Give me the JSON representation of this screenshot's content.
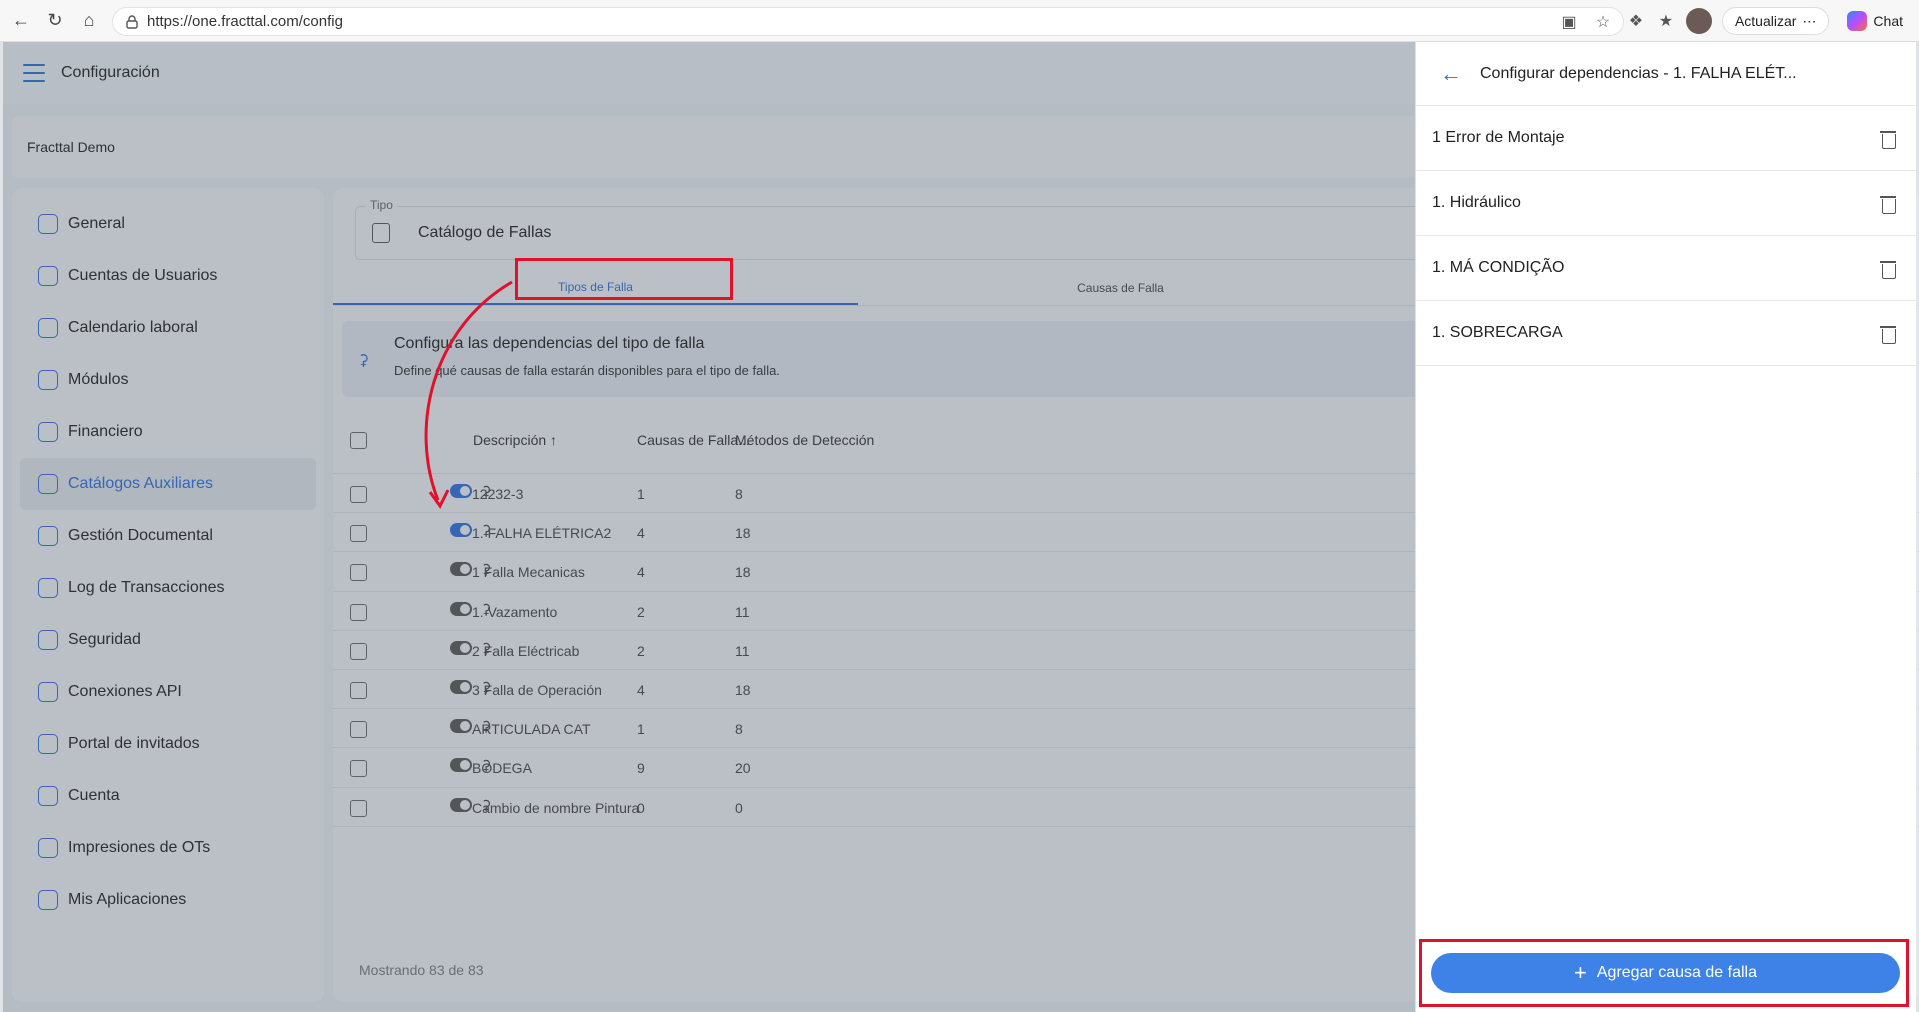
{
  "browser": {
    "url": "https://one.fracttal.com/config",
    "update_label": "Actualizar",
    "chat_label": "Chat"
  },
  "app": {
    "title": "Configuración",
    "company": "Fracttal Demo"
  },
  "sidebar": {
    "items": [
      {
        "label": "General",
        "icon": "home-icon"
      },
      {
        "label": "Cuentas de Usuarios",
        "icon": "user-icon"
      },
      {
        "label": "Calendario laboral",
        "icon": "calendar-icon"
      },
      {
        "label": "Módulos",
        "icon": "list-icon"
      },
      {
        "label": "Financiero",
        "icon": "money-icon"
      },
      {
        "label": "Catálogos Auxiliares",
        "icon": "catalog-icon",
        "active": true
      },
      {
        "label": "Gestión Documental",
        "icon": "document-icon"
      },
      {
        "label": "Log de Transacciones",
        "icon": "log-icon"
      },
      {
        "label": "Seguridad",
        "icon": "shield-icon"
      },
      {
        "label": "Conexiones API",
        "icon": "api-icon"
      },
      {
        "label": "Portal de invitados",
        "icon": "portal-icon"
      },
      {
        "label": "Cuenta",
        "icon": "account-icon"
      },
      {
        "label": "Impresiones de OTs",
        "icon": "printer-icon"
      },
      {
        "label": "Mis Aplicaciones",
        "icon": "globe-icon"
      }
    ]
  },
  "main": {
    "tipo_label": "Tipo",
    "tipo_value": "Catálogo de Fallas",
    "tabs": [
      "Tipos de Falla",
      "Causas de Falla"
    ],
    "info_title": "Configura las dependencias del tipo de falla",
    "info_subtitle": "Define qué causas de falla estarán disponibles para el tipo de falla.",
    "columns": [
      "Descripción",
      "Causas de Falla...",
      "Métodos de Detección"
    ],
    "rows": [
      {
        "desc": "12232-3",
        "causas": "1",
        "metodos": "8",
        "enabled": true
      },
      {
        "desc": "1. FALHA ELÉTRICA2",
        "causas": "4",
        "metodos": "18",
        "enabled": true
      },
      {
        "desc": "1 Falla Mecanicas",
        "causas": "4",
        "metodos": "18",
        "enabled": false
      },
      {
        "desc": "1. Vazamento",
        "causas": "2",
        "metodos": "11",
        "enabled": false
      },
      {
        "desc": "2 Falla Eléctricab",
        "causas": "2",
        "metodos": "11",
        "enabled": false
      },
      {
        "desc": "3 Falla de Operación",
        "causas": "4",
        "metodos": "18",
        "enabled": false
      },
      {
        "desc": "ARTICULADA CAT",
        "causas": "1",
        "metodos": "8",
        "enabled": false
      },
      {
        "desc": "BODEGA",
        "causas": "9",
        "metodos": "20",
        "enabled": false
      },
      {
        "desc": "Cambio de nombre Pintura",
        "causas": "0",
        "metodos": "0",
        "enabled": false
      }
    ],
    "footer": "Mostrando 83 de 83"
  },
  "drawer": {
    "title": "Configurar dependencias - 1. FALHA ELÉT...",
    "items": [
      "1 Error de Montaje",
      "1. Hidráulico",
      "1. MÁ CONDIÇÃO",
      "1. SOBRECARGA"
    ],
    "add_button": "Agregar causa de falla"
  },
  "colors": {
    "accent": "#2d6bd3",
    "button": "#3e82e8",
    "annotation": "#e0112b"
  }
}
